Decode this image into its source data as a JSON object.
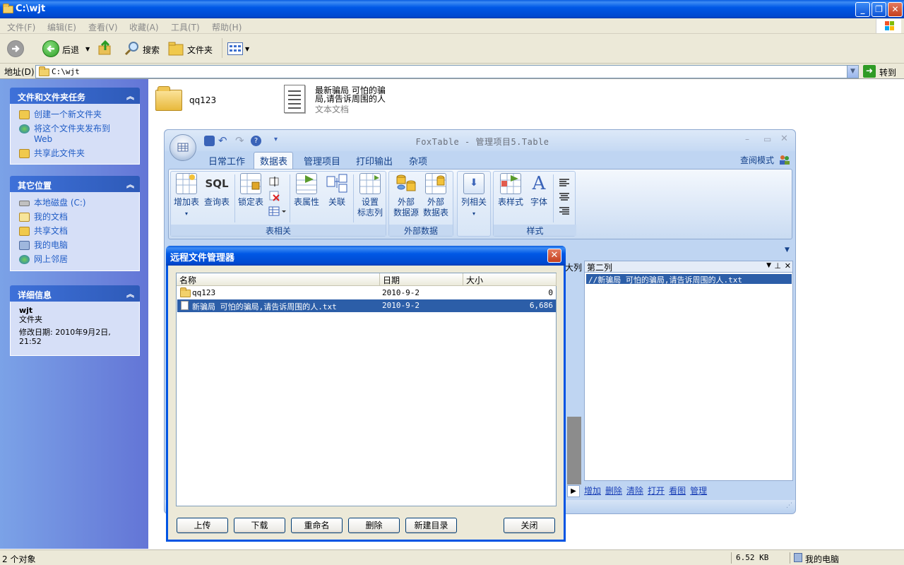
{
  "window": {
    "title": "C:\\wjt"
  },
  "menu": [
    "文件(F)",
    "编辑(E)",
    "查看(V)",
    "收藏(A)",
    "工具(T)",
    "帮助(H)"
  ],
  "toolbar": {
    "back": "后退",
    "search": "搜索",
    "folders": "文件夹"
  },
  "address": {
    "label": "地址(D)",
    "value": "C:\\wjt",
    "go": "转到"
  },
  "tasks": {
    "title": "文件和文件夹任务",
    "items": [
      "创建一个新文件夹",
      "将这个文件夹发布到",
      "Web",
      "共享此文件夹"
    ]
  },
  "places": {
    "title": "其它位置",
    "items": [
      "本地磁盘 (C:)",
      "我的文档",
      "共享文档",
      "我的电脑",
      "网上邻居"
    ]
  },
  "details": {
    "title": "详细信息",
    "name": "wjt",
    "type": "文件夹",
    "modified": "修改日期: 2010年9月2日,",
    "time": "21:52"
  },
  "files": [
    {
      "name": "qq123"
    },
    {
      "name": "最新骗局 可怕的骗",
      "name2": "局,请告诉周围的人",
      "type": "文本文档"
    }
  ],
  "status": {
    "count": "2 个对象",
    "size": "6.52 KB",
    "location": "我的电脑"
  },
  "foxtable": {
    "title": "FoxTable - 管理项目5.Table",
    "tabs": [
      "日常工作",
      "数据表",
      "管理项目",
      "打印输出",
      "杂项"
    ],
    "mode": "查阅模式",
    "groups": {
      "table": "表相关",
      "external": "外部数据",
      "style": "样式"
    },
    "buttons": {
      "add_table": "增加表",
      "sql": "SQL",
      "query_table": "查询表",
      "lock_table": "锁定表",
      "table_props": "表属性",
      "relation": "关联",
      "set": "设置",
      "flag_col": "标志列",
      "external": "外部",
      "datasource": "数据源",
      "external2": "外部",
      "datatable": "数据表",
      "col_related": "列相关",
      "table_style": "表样式",
      "font": "字体"
    },
    "pane": {
      "header": "第二列",
      "cell": "//新骗局 可怕的骗局,请告诉周围的人.txt",
      "col_left": "大列"
    },
    "links": [
      "增加",
      "删除",
      "清除",
      "打开",
      "看图",
      "管理"
    ]
  },
  "dialog": {
    "title": "远程文件管理器",
    "columns": [
      "名称",
      "日期",
      "大小"
    ],
    "rows": [
      {
        "name": "qq123",
        "date": "2010-9-2",
        "size": "0"
      },
      {
        "name": "新骗局  可怕的骗局,请告诉周围的人.txt",
        "date": "2010-9-2",
        "size": "6,686"
      }
    ],
    "buttons": [
      "上传",
      "下载",
      "重命名",
      "删除",
      "新建目录",
      "关闭"
    ]
  },
  "colors": {
    "xp_blue": "#0054e3",
    "selection": "#2c5ea8",
    "link": "#215dc6"
  }
}
